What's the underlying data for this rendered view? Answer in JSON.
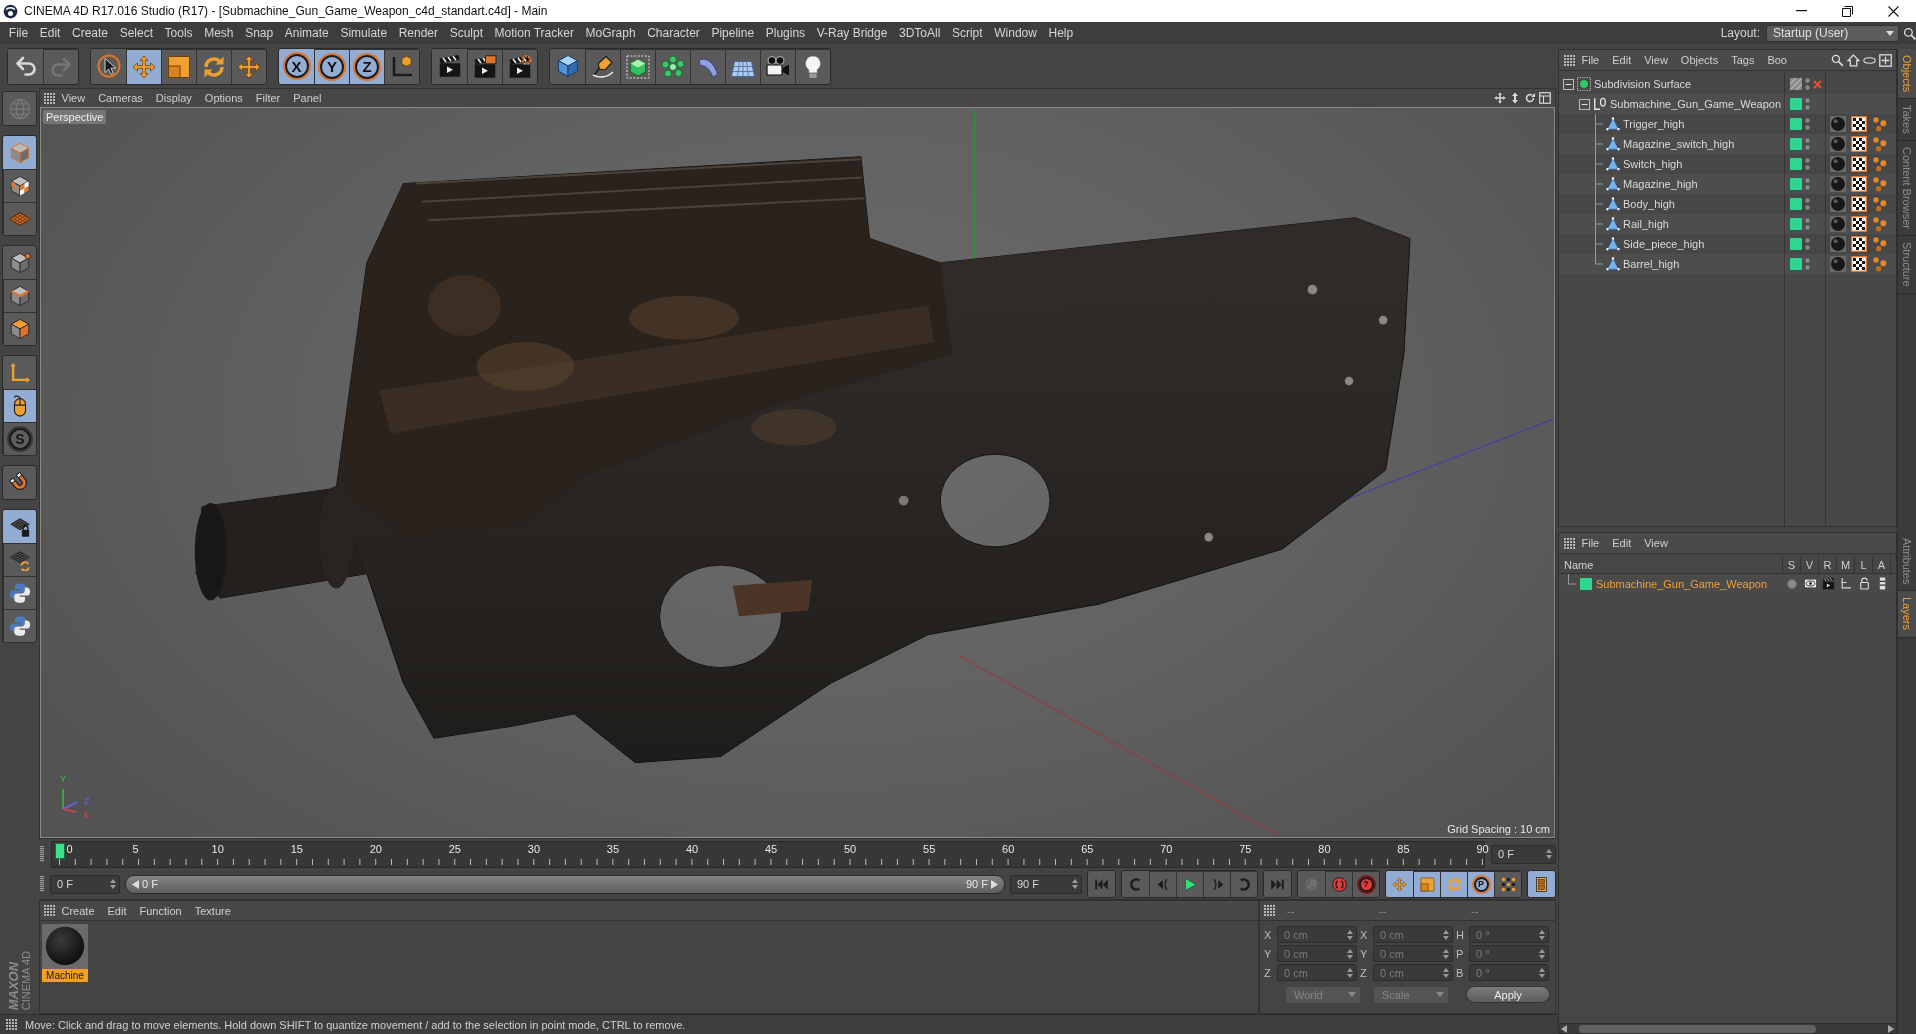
{
  "window": {
    "title": "CINEMA 4D R17.016 Studio (R17) - [Submachine_Gun_Game_Weapon_c4d_standart.c4d] - Main"
  },
  "menu_bar": {
    "items": [
      "File",
      "Edit",
      "Create",
      "Select",
      "Tools",
      "Mesh",
      "Snap",
      "Animate",
      "Simulate",
      "Render",
      "Sculpt",
      "Motion Tracker",
      "MoGraph",
      "Character",
      "Pipeline",
      "Plugins",
      "V-Ray Bridge",
      "3DToAll",
      "Script",
      "Window",
      "Help"
    ],
    "layout_label": "Layout:",
    "layout_value": "Startup (User)"
  },
  "toolbar": [
    {
      "tools": [
        {
          "kind": "undo",
          "selected": false,
          "disabled": false
        },
        {
          "kind": "redo",
          "selected": false,
          "disabled": true
        }
      ]
    },
    {
      "tools": [
        {
          "kind": "select",
          "selected": false,
          "disabled": false
        },
        {
          "kind": "move",
          "selected": true,
          "disabled": false
        },
        {
          "kind": "scale",
          "selected": false,
          "disabled": false
        },
        {
          "kind": "rotate",
          "selected": false,
          "disabled": false
        },
        {
          "kind": "transform",
          "selected": false,
          "disabled": false
        }
      ]
    },
    {
      "tools": [
        {
          "kind": "axis",
          "label": "X",
          "selected": true,
          "disabled": false
        },
        {
          "kind": "axis",
          "label": "Y",
          "selected": true,
          "disabled": false
        },
        {
          "kind": "axis",
          "label": "Z",
          "selected": true,
          "disabled": false
        },
        {
          "kind": "coords",
          "selected": false,
          "disabled": false
        }
      ]
    },
    {
      "tools": [
        {
          "kind": "render_view",
          "selected": false,
          "disabled": false
        },
        {
          "kind": "render",
          "selected": false,
          "disabled": false
        },
        {
          "kind": "render_settings",
          "selected": false,
          "disabled": false
        }
      ]
    },
    {
      "tools": [
        {
          "kind": "cube",
          "selected": false,
          "disabled": false
        },
        {
          "kind": "pen",
          "selected": false,
          "disabled": false
        },
        {
          "kind": "subdivide",
          "selected": false,
          "disabled": false
        },
        {
          "kind": "cloner",
          "selected": false,
          "disabled": false
        },
        {
          "kind": "deformer",
          "selected": false,
          "disabled": false
        },
        {
          "kind": "floor",
          "selected": false,
          "disabled": false
        },
        {
          "kind": "camera",
          "selected": false,
          "disabled": false
        },
        {
          "kind": "light",
          "selected": false,
          "disabled": false
        }
      ]
    }
  ],
  "object_manager": {
    "menu": [
      "File",
      "Edit",
      "View",
      "Objects",
      "Tags",
      "Boo"
    ],
    "tree": [
      {
        "name": "Subdivision Surface",
        "kind": "subdivision",
        "expanded": true,
        "layer": false,
        "enabled": false,
        "children": [
          {
            "name": "Submachine_Gun_Game_Weapon",
            "kind": "null",
            "expanded": true,
            "layer": true,
            "children": [
              {
                "name": "Trigger_high",
                "kind": "polygon",
                "layer": true
              },
              {
                "name": "Magazine_switch_high",
                "kind": "polygon",
                "layer": true
              },
              {
                "name": "Switch_high",
                "kind": "polygon",
                "layer": true
              },
              {
                "name": "Magazine_high",
                "kind": "polygon",
                "layer": true
              },
              {
                "name": "Body_high",
                "kind": "polygon",
                "layer": true
              },
              {
                "name": "Rail_high",
                "kind": "polygon",
                "layer": true
              },
              {
                "name": "Side_piece_high",
                "kind": "polygon",
                "layer": true
              },
              {
                "name": "Barrel_high",
                "kind": "polygon",
                "layer": true
              }
            ]
          }
        ]
      }
    ]
  },
  "side_tabs": {
    "top": [
      {
        "label": "Objects",
        "selected": true
      },
      {
        "label": "Takes",
        "selected": false
      },
      {
        "label": "Content Browser",
        "selected": false
      },
      {
        "label": "Structure",
        "selected": false
      }
    ],
    "bottom": [
      {
        "label": "Attributes",
        "selected": false
      },
      {
        "label": "Layers",
        "selected": true
      }
    ]
  },
  "left_toolbar": [
    {
      "tools": [
        {
          "kind": "editable",
          "selected": false,
          "disabled": true
        }
      ]
    },
    {
      "tools": [
        {
          "kind": "model",
          "selected": true,
          "disabled": false
        },
        {
          "kind": "texture",
          "selected": false,
          "disabled": false
        },
        {
          "kind": "workplane",
          "selected": false,
          "disabled": false
        }
      ]
    },
    {
      "tools": [
        {
          "kind": "points",
          "selected": false,
          "disabled": false
        },
        {
          "kind": "edges",
          "selected": false,
          "disabled": false
        },
        {
          "kind": "polygons",
          "selected": false,
          "disabled": false
        }
      ]
    },
    {
      "tools": [
        {
          "kind": "axis_mode",
          "selected": false,
          "disabled": false
        },
        {
          "kind": "tweak",
          "selected": true,
          "disabled": false
        },
        {
          "kind": "solo",
          "label": "S",
          "selected": false,
          "disabled": false
        }
      ]
    },
    {
      "tools": [
        {
          "kind": "snap",
          "selected": false,
          "disabled": false
        }
      ]
    },
    {
      "tools": [
        {
          "kind": "lock_workplane",
          "selected": true,
          "disabled": false
        },
        {
          "kind": "planar",
          "selected": false,
          "disabled": false
        },
        {
          "kind": "python",
          "selected": false,
          "disabled": false
        },
        {
          "kind": "python",
          "selected": false,
          "disabled": false
        }
      ]
    }
  ],
  "viewport": {
    "menu": [
      "View",
      "Cameras",
      "Display",
      "Options",
      "Filter",
      "Panel"
    ],
    "camera": "Perspective",
    "grid_spacing": "Grid Spacing : 10 cm",
    "axis_labels": [
      "Y",
      "Z",
      "X"
    ]
  },
  "timeline": {
    "ticks": [
      "0",
      "5",
      "10",
      "15",
      "20",
      "25",
      "30",
      "35",
      "40",
      "45",
      "50",
      "55",
      "60",
      "65",
      "70",
      "75",
      "80",
      "85",
      "90"
    ],
    "level": 0,
    "current_frame": "0 F"
  },
  "timeline_controls": {
    "start_frame": "0 F",
    "range": {
      "start": "0 F",
      "end": "90 F"
    },
    "end_frame": "90 F",
    "groups": [
      {
        "tools": [
          {
            "kind": "first",
            "selected": false,
            "disabled": false
          }
        ]
      },
      {
        "tools": [
          {
            "kind": "prev_key",
            "selected": false,
            "disabled": false
          },
          {
            "kind": "prev",
            "selected": false,
            "disabled": false
          },
          {
            "kind": "play",
            "selected": false,
            "disabled": false
          },
          {
            "kind": "next",
            "selected": false,
            "disabled": false
          },
          {
            "kind": "next_key",
            "selected": false,
            "disabled": false
          }
        ]
      },
      {
        "tools": [
          {
            "kind": "last",
            "selected": false,
            "disabled": false
          }
        ]
      },
      {
        "tools": [
          {
            "kind": "key",
            "selected": false,
            "disabled": true
          },
          {
            "kind": "record",
            "selected": false,
            "disabled": false
          },
          {
            "kind": "autokey",
            "label": "?",
            "selected": false,
            "disabled": false
          }
        ]
      },
      {
        "tools": [
          {
            "kind": "pos_key",
            "selected": true,
            "disabled": false
          },
          {
            "kind": "scale_key",
            "selected": true,
            "disabled": false
          },
          {
            "kind": "rot_key",
            "selected": true,
            "disabled": false
          },
          {
            "kind": "param",
            "label": "P",
            "selected": true,
            "disabled": false
          },
          {
            "kind": "pla",
            "selected": false,
            "disabled": false
          }
        ]
      },
      {
        "tools": [
          {
            "kind": "timeline",
            "selected": true,
            "disabled": false
          }
        ]
      }
    ]
  },
  "material_manager": {
    "menu": [
      "Create",
      "Edit",
      "Function",
      "Texture"
    ],
    "materials": [
      {
        "name": "Machine",
        "selected": true
      }
    ]
  },
  "coordinates": {
    "disabled": true,
    "headers": [
      "--",
      "--",
      "--"
    ],
    "rows": [
      {
        "labels": [
          "X",
          "X",
          "H"
        ],
        "values": [
          "0 cm",
          "0 cm",
          "0 °"
        ]
      },
      {
        "labels": [
          "Y",
          "Y",
          "P"
        ],
        "values": [
          "0 cm",
          "0 cm",
          "0 °"
        ]
      },
      {
        "labels": [
          "Z",
          "Z",
          "B"
        ],
        "values": [
          "0 cm",
          "0 cm",
          "0 °"
        ]
      }
    ],
    "dropdowns": [
      "World",
      "Scale"
    ],
    "apply": "Apply"
  },
  "layer_manager": {
    "menu": [
      "File",
      "Edit",
      "View"
    ],
    "columns": [
      "Name",
      "S",
      "V",
      "R",
      "M",
      "L",
      "A"
    ],
    "rows": [
      {
        "name": "Submachine_Gun_Game_Weapon",
        "selected": true
      }
    ]
  },
  "logo": {
    "brand": "MAXON",
    "product": "CINEMA 4D"
  },
  "status_bar": {
    "text": "Move: Click and drag to move elements. Hold down SHIFT to quantize movement / add to the selection in point mode, CTRL to remove."
  }
}
